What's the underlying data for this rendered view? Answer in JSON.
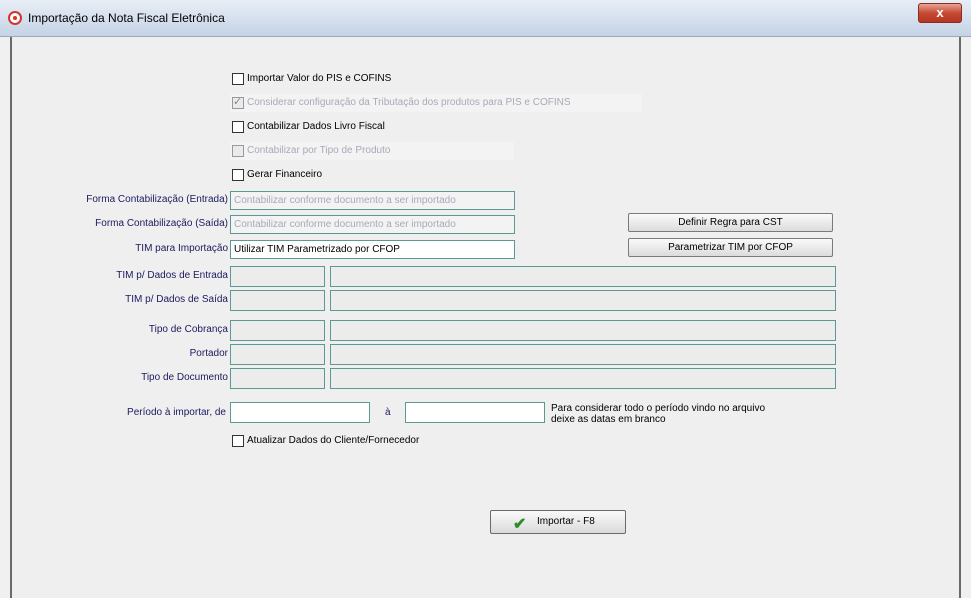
{
  "window": {
    "title": "Importação da Nota Fiscal Eletrônica",
    "close_label": "x"
  },
  "options": {
    "importar_pis_cofins": "Importar Valor do PIS e COFINS",
    "considerar_tributacao": "Considerar configuração da Tributação dos produtos para PIS e COFINS",
    "contabilizar_livro_fiscal": "Contabilizar Dados Livro Fiscal",
    "contabilizar_tipo_produto": "Contabilizar por Tipo de Produto",
    "gerar_financeiro": "Gerar Financeiro",
    "atualizar_cliente": "Atualizar Dados do Cliente/Fornecedor"
  },
  "labels": {
    "forma_entrada": "Forma Contabilização (Entrada)",
    "forma_saida": "Forma Contabilização (Saída)",
    "tim_importacao": "TIM para Importação",
    "tim_entrada": "TIM p/ Dados de Entrada",
    "tim_saida": "TIM p/ Dados de Saída",
    "tipo_cobranca": "Tipo de Cobrança",
    "portador": "Portador",
    "tipo_documento": "Tipo de Documento",
    "periodo": "Período à importar, de",
    "periodo_ate": "à"
  },
  "values": {
    "forma_entrada": "Contabilizar conforme documento a ser importado",
    "forma_saida": "Contabilizar conforme documento a ser importado",
    "tim_importacao": "Utilizar TIM Parametrizado por CFOP"
  },
  "buttons": {
    "definir_regra": "Definir Regra para CST",
    "parametrizar_tim": "Parametrizar TIM por CFOP",
    "importar": "Importar - F8"
  },
  "note": {
    "line1": "Para considerar todo o período vindo no arquivo",
    "line2": "deixe as datas em branco"
  },
  "colors": {
    "field_border": "#5a9a92",
    "label_text": "#1c1a5e",
    "close_button": "#c74a33",
    "ok_icon": "#2e8b2e"
  }
}
